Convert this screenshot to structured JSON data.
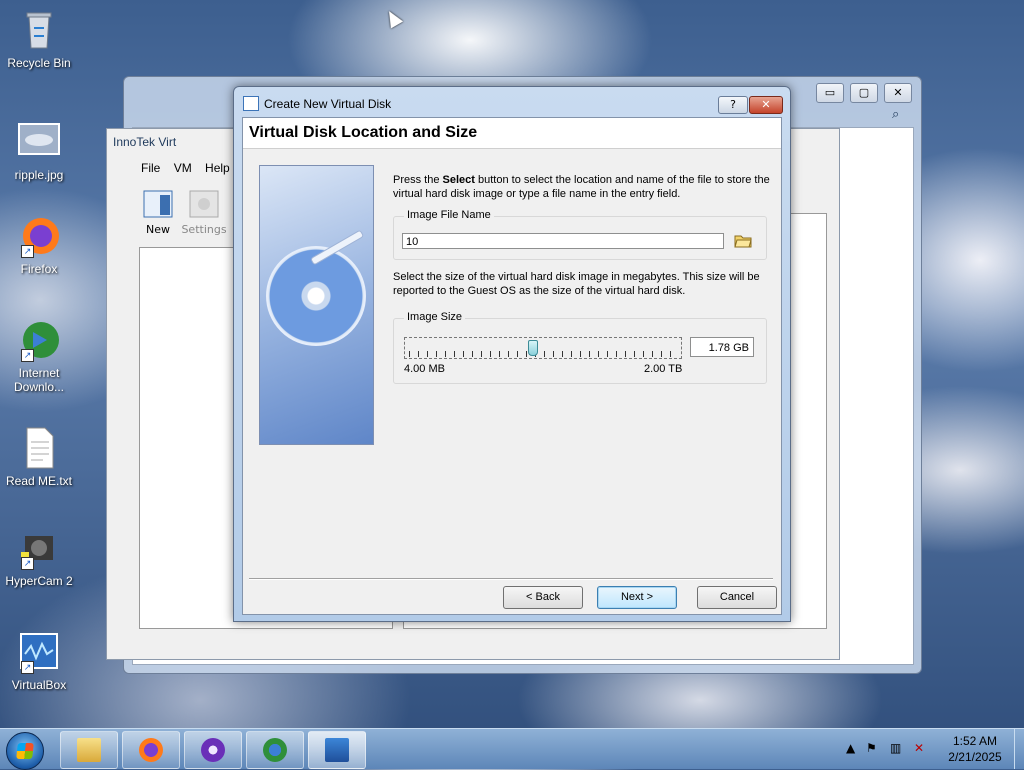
{
  "desktop": {
    "icons": [
      {
        "label": "Recycle Bin"
      },
      {
        "label": "ripple.jpg"
      },
      {
        "label": "Firefox"
      },
      {
        "label": "Internet Downlo..."
      },
      {
        "label": "Read ME.txt"
      },
      {
        "label": "HyperCam 2"
      },
      {
        "label": "VirtualBox"
      }
    ]
  },
  "background_window": {
    "controls": {
      "minimize": "▭",
      "maximize": "▢",
      "close": "✕"
    }
  },
  "innotek_window": {
    "title": "InnoTek Virt",
    "menu": {
      "file": "File",
      "vm": "VM",
      "help": "Help"
    },
    "toolbar": {
      "new": "New",
      "settings": "Settings"
    }
  },
  "dialog": {
    "title": "Create New Virtual Disk",
    "help_glyph": "?",
    "close_glyph": "✕",
    "header": "Virtual Disk Location and Size",
    "desc1_pre": "Press the ",
    "desc1_bold": "Select",
    "desc1_post": " button to select the location and name of the file to store the virtual hard disk image or type a file name in the entry field.",
    "file_group_label": "Image File Name",
    "file_value": "10",
    "desc2": "Select the size of the virtual hard disk image in megabytes. This size will be reported to the Guest OS as the size of the virtual hard disk.",
    "size_group_label": "Image Size",
    "size_value": "1.78 GB",
    "size_min": "4.00 MB",
    "size_max": "2.00 TB",
    "buttons": {
      "back": "< Back",
      "next": "Next >",
      "cancel": "Cancel"
    }
  },
  "taskbar": {
    "time": "1:52 AM",
    "date": "2/21/2025"
  },
  "colors": {
    "accent": "#3c7fb1",
    "close_red": "#c4432a"
  }
}
